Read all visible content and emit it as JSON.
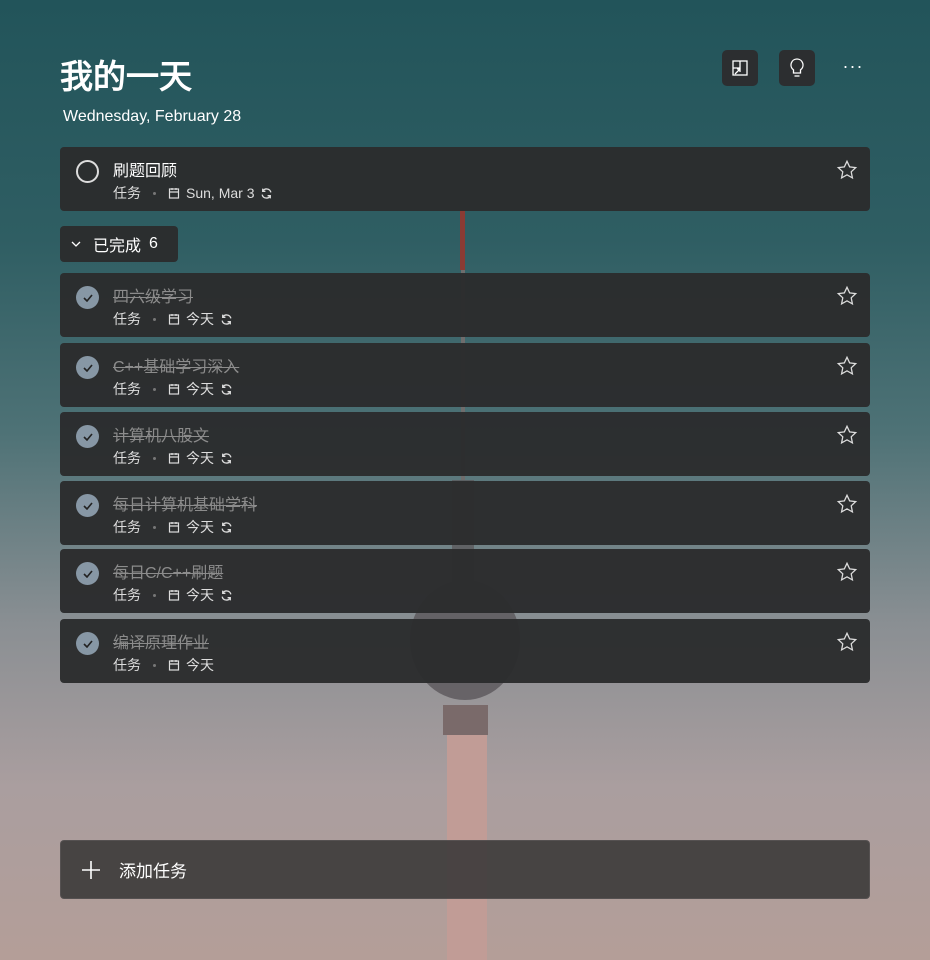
{
  "header": {
    "title": "我的一天",
    "date": "Wednesday, February 28"
  },
  "toolbar": {
    "icons": [
      "background-icon",
      "suggestions-bulb-icon",
      "more-icon"
    ],
    "more_label": "···"
  },
  "open_tasks": [
    {
      "title": "刷题回顾",
      "list": "任务",
      "due": "Sun, Mar 3",
      "repeat": true
    }
  ],
  "completed": {
    "label": "已完成",
    "count": "6",
    "items": [
      {
        "title": "四六级学习",
        "list": "任务",
        "due": "今天",
        "repeat": true
      },
      {
        "title": "C++基础学习深入",
        "list": "任务",
        "due": "今天",
        "repeat": true
      },
      {
        "title": "计算机八股文",
        "list": "任务",
        "due": "今天",
        "repeat": true
      },
      {
        "title": "每日计算机基础学科",
        "list": "任务",
        "due": "今天",
        "repeat": true
      },
      {
        "title": "每日C/C++刷题",
        "list": "任务",
        "due": "今天",
        "repeat": true
      },
      {
        "title": "编译原理作业",
        "list": "任务",
        "due": "今天",
        "repeat": false
      }
    ]
  },
  "add_task": {
    "label": "添加任务"
  },
  "colors": {
    "card": "#2b2c2d",
    "check": "#8797a5"
  }
}
